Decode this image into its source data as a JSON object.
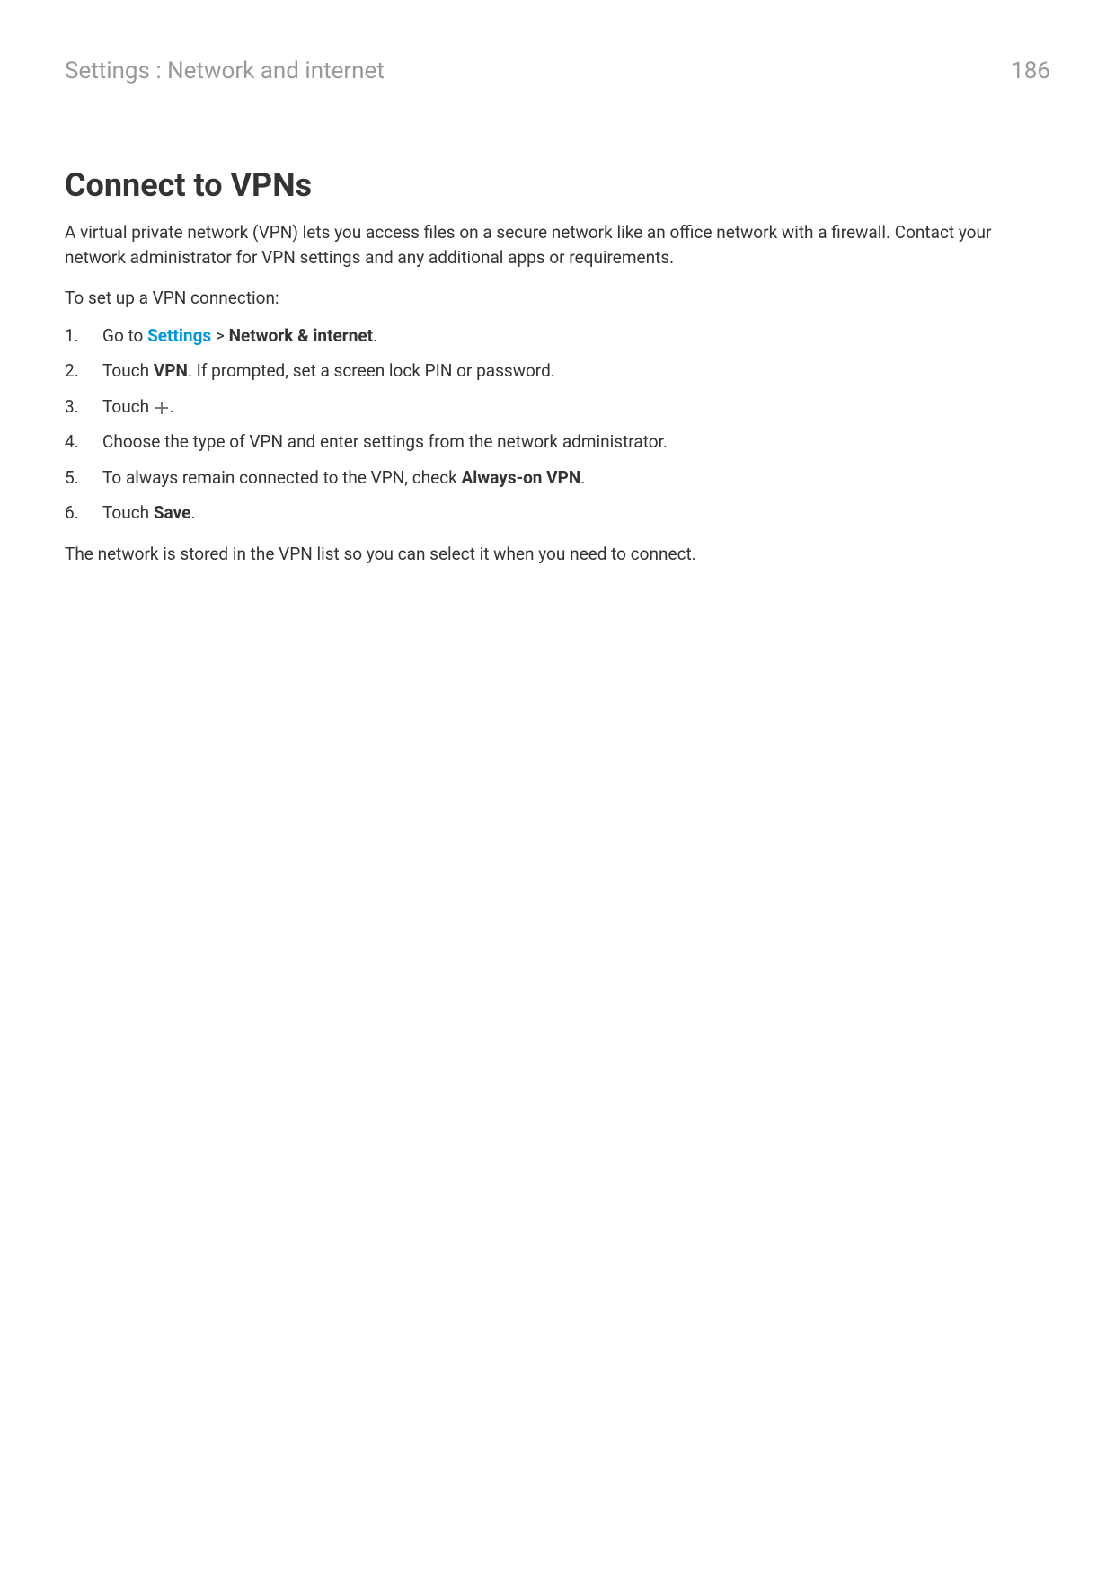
{
  "header": {
    "breadcrumb": "Settings : Network and internet",
    "pageNumber": "186"
  },
  "title": "Connect to VPNs",
  "intro": "A virtual private network (VPN) lets you access files on a secure network like an office network with a firewall. Contact your network administrator for VPN settings and any additional apps or requirements.",
  "lead": "To set up a VPN connection:",
  "steps": {
    "s1_prefix": "Go to ",
    "s1_link": "Settings",
    "s1_sep": " > ",
    "s1_bold": "Network & internet",
    "s1_suffix": ".",
    "s2_prefix": "Touch ",
    "s2_bold": "VPN",
    "s2_suffix": ". If prompted, set a screen lock PIN or password.",
    "s3_prefix": "Touch ",
    "s3_suffix": ".",
    "s4": "Choose the type of VPN and enter settings from the network administrator.",
    "s5_prefix": "To always remain connected to the VPN, check ",
    "s5_bold": "Always-on VPN",
    "s5_suffix": ".",
    "s6_prefix": "Touch ",
    "s6_bold": "Save",
    "s6_suffix": "."
  },
  "outro": "The network is stored in the VPN list so you can select it when you need to connect."
}
